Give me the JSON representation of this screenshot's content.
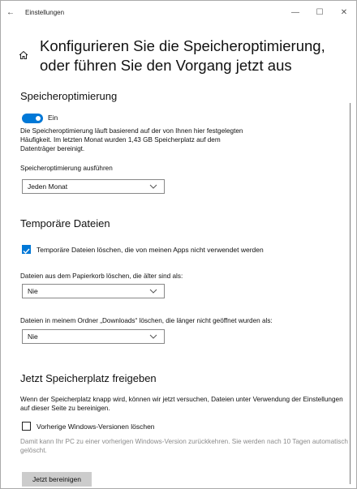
{
  "window": {
    "title": "Einstellungen",
    "back_glyph": "←",
    "minimize_glyph": "—",
    "maximize_glyph": "☐",
    "close_glyph": "✕"
  },
  "header": {
    "home_icon": "home-icon",
    "title": "Konfigurieren Sie die Speicheroptimierung, oder führen Sie den Vorgang jetzt aus"
  },
  "storage_sense": {
    "heading": "Speicheroptimierung",
    "toggle_state": "Ein",
    "description": "Die Speicheroptimierung läuft basierend auf der von Ihnen hier festgelegten Häufigkeit. Im letzten Monat wurden 1,43 GB Speicherplatz auf dem Datenträger bereinigt.",
    "run_label": "Speicheroptimierung ausführen",
    "run_value": "Jeden Monat"
  },
  "temp_files": {
    "heading": "Temporäre Dateien",
    "delete_unused_label": "Temporäre Dateien löschen, die von meinen Apps nicht verwendet werden",
    "delete_unused_checked": true,
    "recycle_label": "Dateien aus dem Papierkorb löschen, die älter sind als:",
    "recycle_value": "Nie",
    "downloads_label": "Dateien in meinem Ordner „Downloads“ löschen, die länger nicht geöffnet wurden als:",
    "downloads_value": "Nie"
  },
  "free_now": {
    "heading": "Jetzt Speicherplatz freigeben",
    "description": "Wenn der Speicherplatz knapp wird, können wir jetzt versuchen, Dateien unter Verwendung der Einstellungen auf dieser Seite zu bereinigen.",
    "previous_versions_label": "Vorherige Windows-Versionen löschen",
    "previous_versions_checked": false,
    "previous_versions_note": "Damit kann Ihr PC zu einer vorherigen Windows-Version zurückkehren. Sie werden nach 10 Tagen automatisch gelöscht.",
    "clean_button": "Jetzt bereinigen"
  },
  "colors": {
    "accent": "#0078d7",
    "button_bg": "#cccccc",
    "muted_text": "#8a8a8a"
  }
}
